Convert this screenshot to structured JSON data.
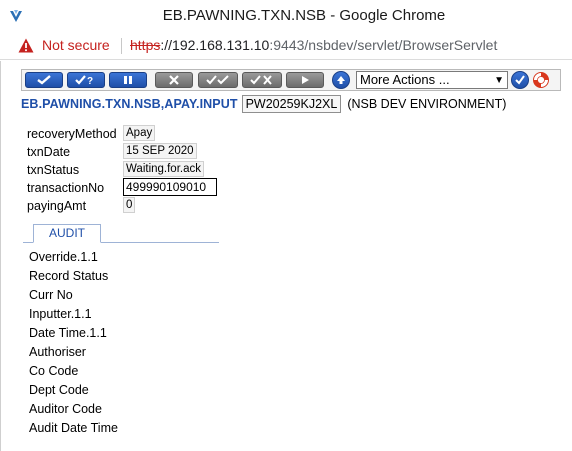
{
  "window": {
    "title": "EB.PAWNING.TXN.NSB - Google Chrome"
  },
  "addressbar": {
    "security_label": "Not secure",
    "url_scheme": "https",
    "url_host": "://192.168.131.10",
    "url_rest": ":9443/nsbdev/servlet/BrowserServlet"
  },
  "toolbar": {
    "more_actions_label": "More Actions ..."
  },
  "header": {
    "app_title": "EB.PAWNING.TXN.NSB,APAY.INPUT",
    "record_id": "PW20259KJ2XL",
    "environment": "(NSB DEV ENVIRONMENT)"
  },
  "fields": [
    {
      "label": "recoveryMethod",
      "value": "Apay"
    },
    {
      "label": "txnDate",
      "value": "15 SEP 2020"
    },
    {
      "label": "txnStatus",
      "value": "Waiting.for.ack"
    },
    {
      "label": "transactionNo",
      "value": "499990109010"
    },
    {
      "label": "payingAmt",
      "value": "0"
    }
  ],
  "tabs": [
    {
      "label": "AUDIT"
    }
  ],
  "audit": [
    "Override.1.1",
    "Record Status",
    "Curr No",
    "Inputter.1.1",
    "Date Time.1.1",
    "Authoriser",
    "Co Code",
    "Dept Code",
    "Auditor Code",
    "Audit Date Time"
  ]
}
